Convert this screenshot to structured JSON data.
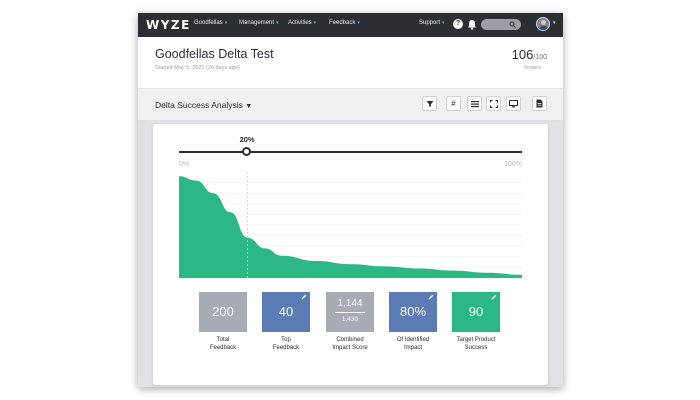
{
  "nav": {
    "logo": "WYZE",
    "items": [
      "Goodfellas",
      "Management",
      "Activities",
      "Feedback"
    ],
    "support": "Support",
    "help": "?"
  },
  "header": {
    "title": "Goodfellas Delta Test",
    "subtitle": "Started May 5, 2021 (26 days ago)",
    "count": "106",
    "count_total": "/100",
    "count_label": "Testers"
  },
  "toolbar": {
    "analysis": "Delta Success Analysis",
    "buttons": [
      "filter-icon",
      "hash-icon",
      "list-icon",
      "expand-icon",
      "monitor-icon",
      "document-icon"
    ]
  },
  "slider": {
    "value_label": "20%",
    "value": 0.2,
    "min_label": "0%",
    "max_label": "100%"
  },
  "chart_data": {
    "type": "area",
    "x": [
      0,
      5,
      10,
      15,
      20,
      25,
      30,
      40,
      50,
      60,
      70,
      80,
      90,
      100
    ],
    "values": [
      96,
      92,
      80,
      62,
      38,
      28,
      21,
      16,
      13,
      11,
      9,
      7,
      5,
      3
    ],
    "ylim": [
      0,
      100
    ],
    "marker_x": 20,
    "grid": true,
    "color": "#2bb886"
  },
  "metrics": [
    {
      "value": "200",
      "label": "Total\nFeedback",
      "color": "#a6abb4"
    },
    {
      "value": "40",
      "label": "Top\nFeedback",
      "color": "#5b7bb4"
    },
    {
      "value": "1,144",
      "value2": "1,430",
      "label": "Combined\nImpact Score",
      "color": "#a6abb4"
    },
    {
      "value": "80%",
      "label": "Of Identified\nImpact",
      "color": "#5b7bb4"
    },
    {
      "value": "90",
      "label": "Target Product\nSuccess",
      "color": "#2bb886"
    }
  ]
}
